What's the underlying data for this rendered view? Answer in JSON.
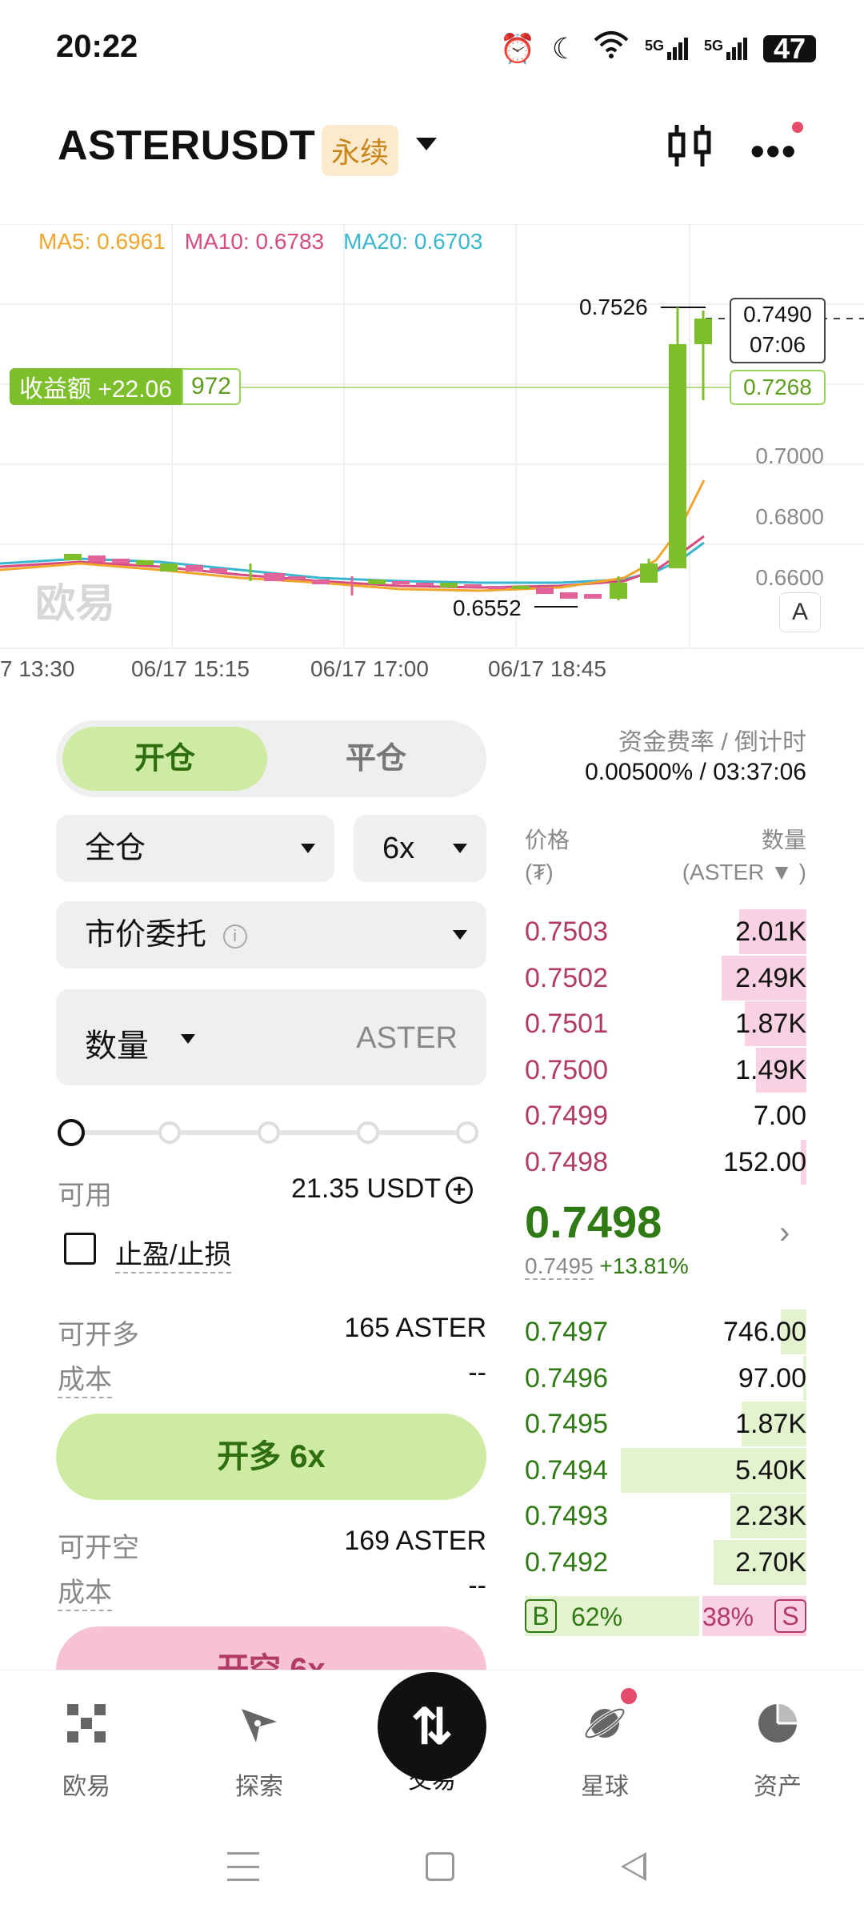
{
  "status_bar": {
    "time": "20:22",
    "icons": [
      "alarm-icon",
      "moon-icon",
      "wifi-icon",
      "signal-5g-icon",
      "signal-5g-icon",
      "battery-icon"
    ],
    "net1": "5G",
    "net2": "5G",
    "battery": "47"
  },
  "header": {
    "symbol": "ASTERUSDT",
    "badge": "永续"
  },
  "chart": {
    "ma5": "MA5: 0.6961",
    "ma10": "MA10: 0.6783",
    "ma20": "MA20: 0.6703",
    "price_ticks": [
      "0.7000",
      "0.6800",
      "0.6600"
    ],
    "profit_label": "收益额 +22.06",
    "profit_qty": "972",
    "position_price": "0.7268",
    "last_price": "0.7490",
    "countdown": "07:06",
    "high": "0.7526",
    "low": "0.6552",
    "auto_label": "A",
    "watermark": "欧易",
    "time_ticks": [
      "7 13:30",
      "06/17 15:15",
      "06/17 17:00",
      "06/17 18:45"
    ],
    "colors": {
      "up": "#7cbf2a",
      "down": "#e0649a",
      "ma5": "#f0a52c",
      "ma10": "#d64b81",
      "ma20": "#3ab6cf"
    }
  },
  "trade": {
    "tab_open": "开仓",
    "tab_close": "平仓",
    "margin_mode": "全仓",
    "leverage": "6x",
    "order_type": "市价委托",
    "qty_label": "数量",
    "qty_unit": "ASTER",
    "slider_level": 0,
    "available_label": "可用",
    "available_value": "21.35 USDT",
    "tpsl_label": "止盈/止损",
    "long_max_label": "可开多",
    "long_max_value": "165 ASTER",
    "long_cost_label": "成本",
    "long_cost_value": "--",
    "long_button": "开多 6x",
    "short_max_label": "可开空",
    "short_max_value": "169 ASTER",
    "short_cost_label": "成本",
    "short_cost_value": "--",
    "short_button": "开空 6x"
  },
  "orderbook": {
    "funding_label": "资金费率 / 倒计时",
    "funding_value": "0.00500% / 03:37:06",
    "head_price": "价格",
    "head_price_unit": "(₮)",
    "head_qty": "数量",
    "head_qty_unit": "(ASTER ▼ )",
    "asks": [
      {
        "price": "0.7503",
        "qty": "2.01K",
        "depth": 0.24
      },
      {
        "price": "0.7502",
        "qty": "2.49K",
        "depth": 0.3
      },
      {
        "price": "0.7501",
        "qty": "1.87K",
        "depth": 0.22
      },
      {
        "price": "0.7500",
        "qty": "1.49K",
        "depth": 0.18
      },
      {
        "price": "0.7499",
        "qty": "7.00",
        "depth": 0.0
      },
      {
        "price": "0.7498",
        "qty": "152.00",
        "depth": 0.02
      }
    ],
    "mid_price": "0.7498",
    "mid_ref": "0.7495",
    "mid_change": "+13.81%",
    "bids": [
      {
        "price": "0.7497",
        "qty": "746.00",
        "depth": 0.09
      },
      {
        "price": "0.7496",
        "qty": "97.00",
        "depth": 0.01
      },
      {
        "price": "0.7495",
        "qty": "1.87K",
        "depth": 0.23
      },
      {
        "price": "0.7494",
        "qty": "5.40K",
        "depth": 0.66
      },
      {
        "price": "0.7493",
        "qty": "2.23K",
        "depth": 0.27
      },
      {
        "price": "0.7492",
        "qty": "2.70K",
        "depth": 0.33
      }
    ],
    "buy_label": "B",
    "buy_pct": "62%",
    "sell_pct": "38%",
    "sell_label": "S"
  },
  "bottom_nav": {
    "items": [
      {
        "label": "欧易",
        "icon": "okx-logo-icon"
      },
      {
        "label": "探索",
        "icon": "compass-icon"
      },
      {
        "label": "交易",
        "icon": "trade-swap-icon"
      },
      {
        "label": "星球",
        "icon": "planet-icon"
      },
      {
        "label": "资产",
        "icon": "pie-chart-icon"
      }
    ]
  }
}
